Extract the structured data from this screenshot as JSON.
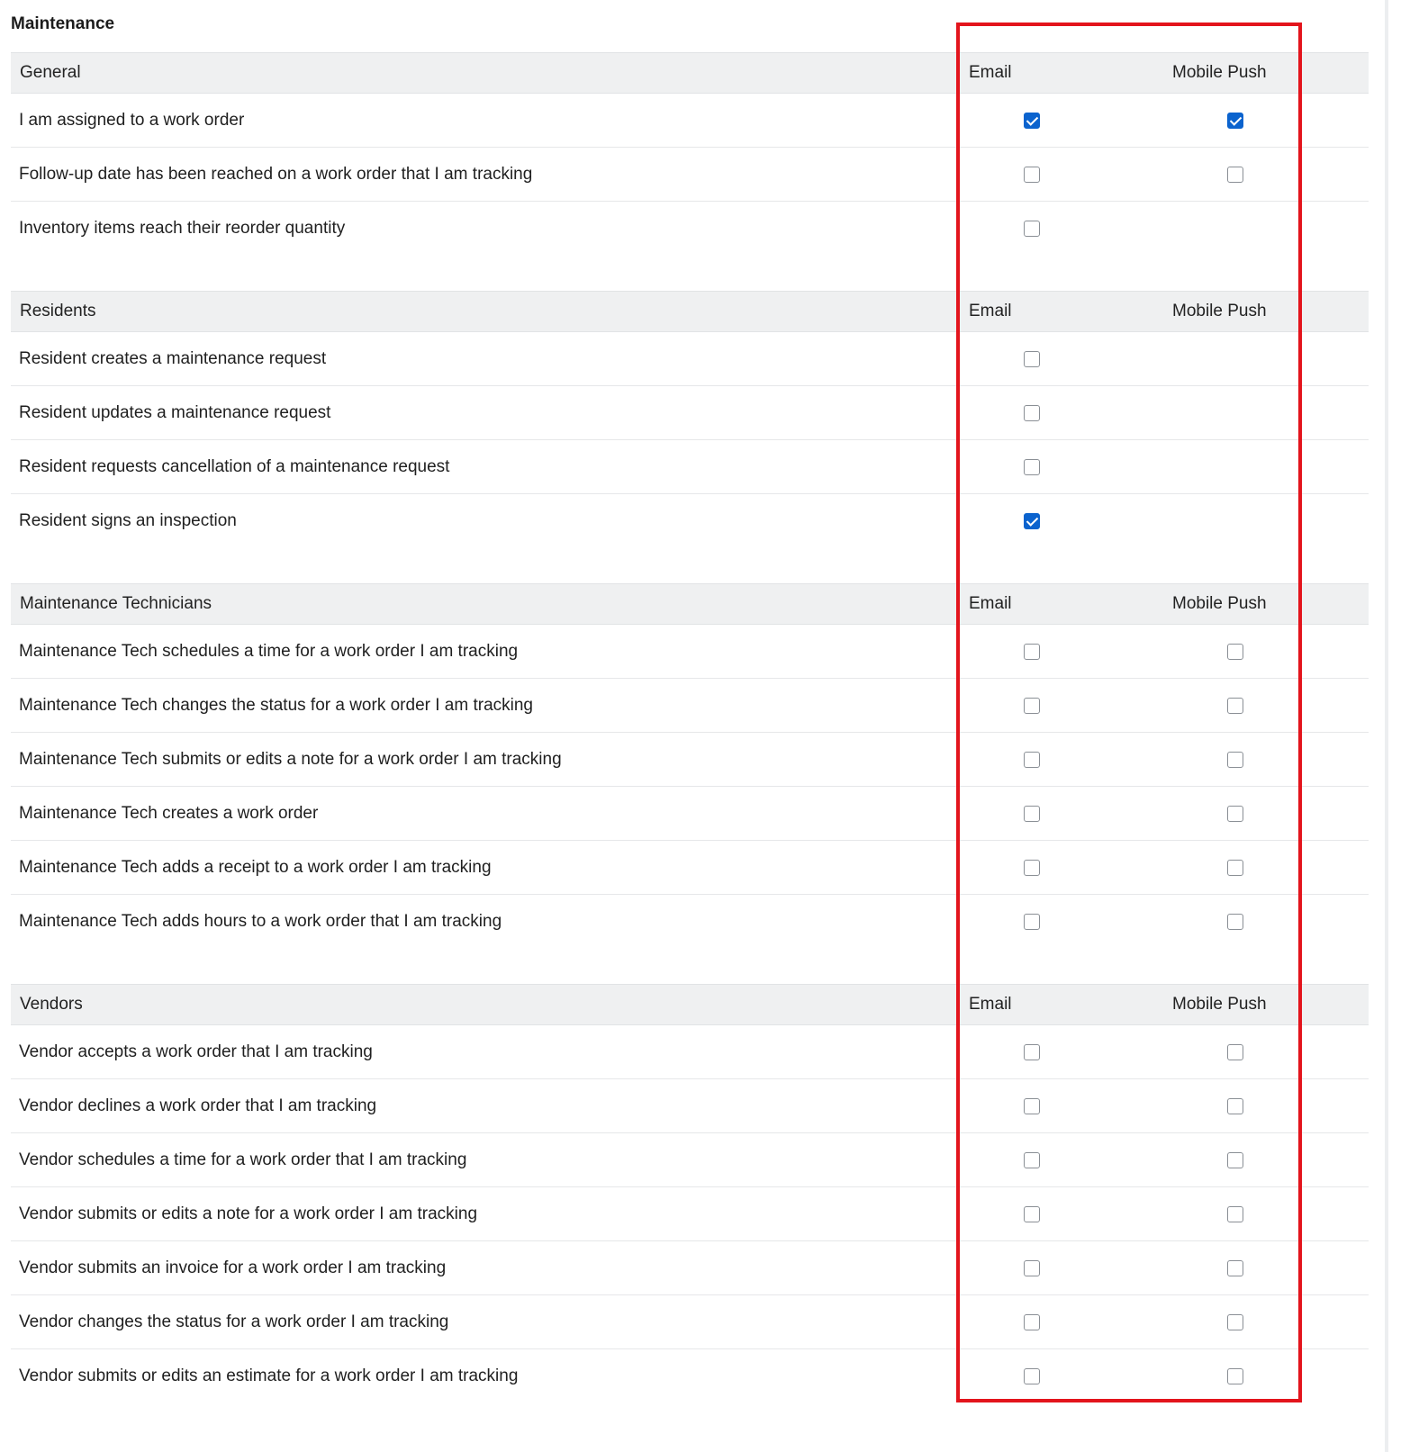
{
  "page": {
    "title": "Maintenance"
  },
  "columns": {
    "email": "Email",
    "push": "Mobile Push"
  },
  "colors": {
    "checked": "#0b63ce",
    "highlight": "#e3141c",
    "header_bg": "#eff0f1"
  },
  "sections": [
    {
      "title": "General",
      "rows": [
        {
          "label": "I am assigned to a work order",
          "email": true,
          "push": true
        },
        {
          "label": "Follow-up date has been reached on a work order that I am tracking",
          "email": false,
          "push": false
        },
        {
          "label": "Inventory items reach their reorder quantity",
          "email": false,
          "push": null
        }
      ]
    },
    {
      "title": "Residents",
      "rows": [
        {
          "label": "Resident creates a maintenance request",
          "email": false,
          "push": null
        },
        {
          "label": "Resident updates a maintenance request",
          "email": false,
          "push": null
        },
        {
          "label": "Resident requests cancellation of a maintenance request",
          "email": false,
          "push": null
        },
        {
          "label": "Resident signs an inspection",
          "email": true,
          "push": null
        }
      ]
    },
    {
      "title": "Maintenance Technicians",
      "rows": [
        {
          "label": "Maintenance Tech schedules a time for a work order I am tracking",
          "email": false,
          "push": false
        },
        {
          "label": "Maintenance Tech changes the status for a work order I am tracking",
          "email": false,
          "push": false
        },
        {
          "label": "Maintenance Tech submits or edits a note for a work order I am tracking",
          "email": false,
          "push": false
        },
        {
          "label": "Maintenance Tech creates a work order",
          "email": false,
          "push": false
        },
        {
          "label": "Maintenance Tech adds a receipt to a work order I am tracking",
          "email": false,
          "push": false
        },
        {
          "label": "Maintenance Tech adds hours to a work order that I am tracking",
          "email": false,
          "push": false
        }
      ]
    },
    {
      "title": "Vendors",
      "rows": [
        {
          "label": "Vendor accepts a work order that I am tracking",
          "email": false,
          "push": false
        },
        {
          "label": "Vendor declines a work order that I am tracking",
          "email": false,
          "push": false
        },
        {
          "label": "Vendor schedules a time for a work order that I am tracking",
          "email": false,
          "push": false
        },
        {
          "label": "Vendor submits or edits a note for a work order I am tracking",
          "email": false,
          "push": false
        },
        {
          "label": "Vendor submits an invoice for a work order I am tracking",
          "email": false,
          "push": false
        },
        {
          "label": "Vendor changes the status for a work order I am tracking",
          "email": false,
          "push": false
        },
        {
          "label": "Vendor submits or edits an estimate for a work order I am tracking",
          "email": false,
          "push": false
        }
      ]
    }
  ]
}
